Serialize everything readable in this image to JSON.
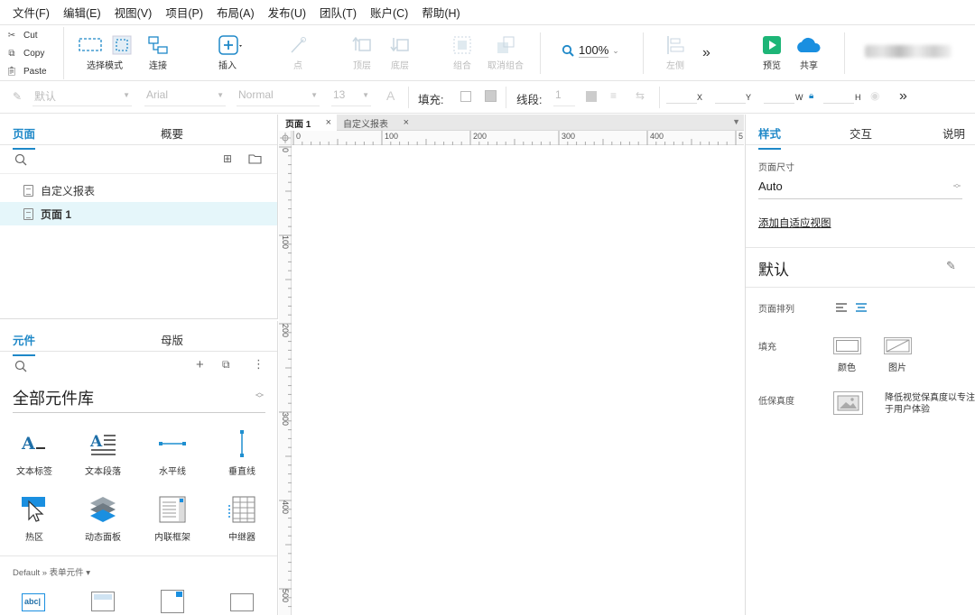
{
  "menu": [
    "文件(F)",
    "编辑(E)",
    "视图(V)",
    "项目(P)",
    "布局(A)",
    "发布(U)",
    "团队(T)",
    "账户(C)",
    "帮助(H)"
  ],
  "clipboard": {
    "cut": "Cut",
    "copy": "Copy",
    "paste": "Paste"
  },
  "toolbar": {
    "select_mode": "选择模式",
    "connect": "连接",
    "insert": "插入",
    "point": "点",
    "top_layer": "顶层",
    "bottom_layer": "底层",
    "group": "组合",
    "ungroup": "取消组合",
    "zoom": "100%",
    "left": "左侧",
    "preview": "预览",
    "share": "共享"
  },
  "format": {
    "style": "默认",
    "font": "Arial",
    "weight": "Normal",
    "size": "13",
    "font_color_glyph": "A",
    "fill_label": "填充:",
    "line_label": "线段:",
    "line_width": "1",
    "x": "X",
    "y": "Y",
    "w": "W",
    "h": "H"
  },
  "pages_panel": {
    "tab_pages": "页面",
    "tab_outline": "概要",
    "pages": [
      "自定义报表",
      "页面 1"
    ],
    "selected_index": 1
  },
  "widgets_panel": {
    "tab_widgets": "元件",
    "tab_masters": "母版",
    "library": "全部元件库",
    "items": [
      "文本标签",
      "文本段落",
      "水平线",
      "垂直线",
      "热区",
      "动态面板",
      "内联框架",
      "中继器"
    ],
    "section_label": "Default » 表单元件 ▾",
    "form_icon_text": "abc|"
  },
  "canvas": {
    "tabs": [
      "页面 1",
      "自定义报表"
    ],
    "active_tab": 0,
    "ruler_h": [
      "0",
      "100",
      "200",
      "300",
      "400",
      "5"
    ],
    "ruler_v": [
      "0",
      "100",
      "200",
      "300",
      "400",
      "500"
    ]
  },
  "inspector": {
    "tab_style": "样式",
    "tab_interact": "交互",
    "tab_notes": "说明",
    "page_size_label": "页面尺寸",
    "page_size_value": "Auto",
    "adaptive_link": "添加自适应视图",
    "style_name": "默认",
    "page_align_label": "页面排列",
    "fill_label": "填充",
    "fill_color": "颜色",
    "fill_image": "图片",
    "low_fidelity_label": "低保真度",
    "low_fidelity_desc": "降低视觉保真度以专注于用户体验"
  },
  "colors": {
    "accent": "#1e88c8",
    "preview_green": "#1db577",
    "cloud_blue": "#1a8fe0"
  }
}
